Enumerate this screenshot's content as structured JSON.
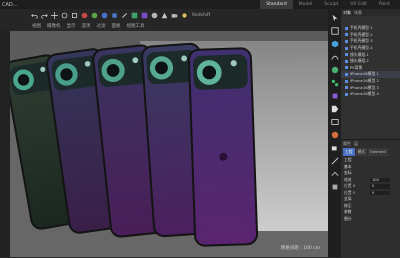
{
  "window": {
    "title": "CAD..."
  },
  "layout_tabs": [
    "Standard",
    "Model",
    "Sculpt",
    "UV Edit",
    "Paint"
  ],
  "toolbar": {
    "row1_label": "视图工具",
    "row2_label": "Redshift",
    "row2_text_items": [
      "视图",
      "摄像机",
      "显示",
      "选项",
      "过滤",
      "面板"
    ]
  },
  "object_manager": {
    "tabs": [
      "对象",
      "场景"
    ],
    "items": [
      {
        "label": "手机壳模型.1"
      },
      {
        "label": "手机壳模型.2"
      },
      {
        "label": "手机壳模型.3"
      },
      {
        "label": "手机壳模型.4"
      },
      {
        "label": "镜头模组.1"
      },
      {
        "label": "镜头模组.2"
      },
      {
        "label": "PS背景"
      },
      {
        "label": "iPhone16模型.1"
      },
      {
        "label": "iPhone16模型.2"
      },
      {
        "label": "iPhone16模型.3"
      },
      {
        "label": "iPhone16模型.4"
      }
    ]
  },
  "attribute_manager": {
    "header_tabs": [
      "属性",
      "层"
    ],
    "mode_tabs": [
      "工程",
      "模式",
      "Element"
    ],
    "title": "工程",
    "rows": [
      {
        "label": "基本"
      },
      {
        "label": "坐标"
      },
      {
        "label": "缩放",
        "value": "100"
      },
      {
        "label": "位置 X",
        "value": "0"
      },
      {
        "label": "位置 Y",
        "value": "0"
      },
      {
        "label": "全局"
      },
      {
        "label": "修正"
      },
      {
        "label": "参数"
      },
      {
        "label": "细分"
      }
    ]
  },
  "viewport": {
    "footer": "网格间距 : 100 cm",
    "phones": [
      {
        "color_top": "#2f3d33",
        "color_bottom": "#1a2820",
        "ring": "#4aa68c"
      },
      {
        "color_top": "#34365a",
        "color_bottom": "#3a1f48",
        "ring": "#4a9e8c"
      },
      {
        "color_top": "#3a3460",
        "color_bottom": "#4a1e58",
        "ring": "#4fa18c"
      },
      {
        "color_top": "#383b62",
        "color_bottom": "#4c1f5e",
        "ring": "#56a98f"
      },
      {
        "color_top": "#3f3070",
        "color_bottom": "#5a2470",
        "ring": "#5fb39c"
      }
    ]
  },
  "colors": {
    "accent": "#3d6cc7",
    "panel": "#313131",
    "bg": "#2b2b2b"
  }
}
